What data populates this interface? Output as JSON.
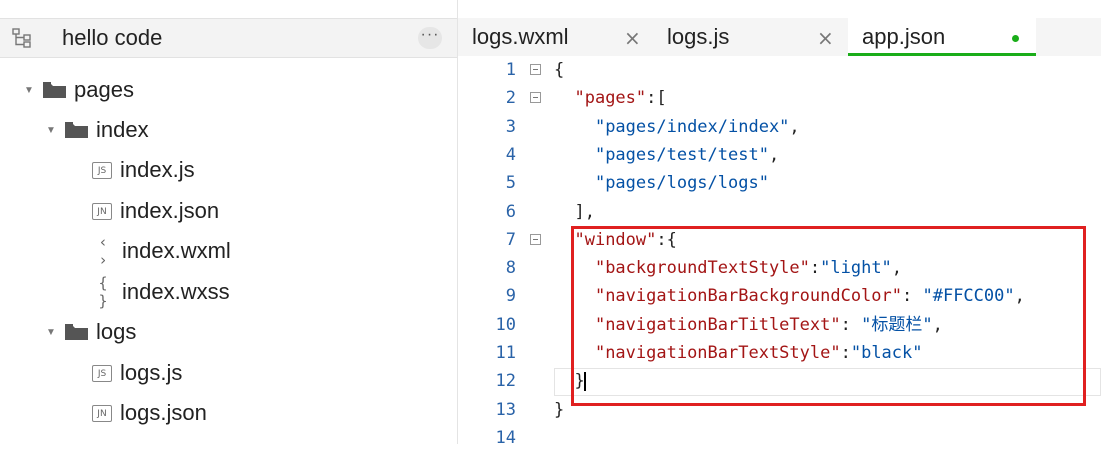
{
  "sidebar": {
    "project_name": "hello code",
    "more_label": "···",
    "tree": [
      {
        "label": "pages",
        "kind": "folder"
      },
      {
        "label": "index",
        "kind": "folder"
      },
      {
        "label": "index.js",
        "kind": "file",
        "badge": "JS"
      },
      {
        "label": "index.json",
        "kind": "file",
        "badge": "JN"
      },
      {
        "label": "index.wxml",
        "kind": "file",
        "badge": "‹ ›"
      },
      {
        "label": "index.wxss",
        "kind": "file",
        "badge": "{ }"
      },
      {
        "label": "logs",
        "kind": "folder"
      },
      {
        "label": "logs.js",
        "kind": "file",
        "badge": "JS"
      },
      {
        "label": "logs.json",
        "kind": "file",
        "badge": "JN"
      }
    ]
  },
  "tabs": [
    {
      "label": "logs.wxml",
      "close": "×"
    },
    {
      "label": "logs.js",
      "close": "×"
    },
    {
      "label": "app.json",
      "active": true,
      "modified": true
    }
  ],
  "editor": {
    "line_numbers": [
      "1",
      "2",
      "3",
      "4",
      "5",
      "6",
      "7",
      "8",
      "9",
      "10",
      "11",
      "12",
      "13",
      "14"
    ],
    "lines": [
      {
        "parts": [
          {
            "t": "{",
            "c": "p"
          }
        ]
      },
      {
        "parts": [
          {
            "t": "  ",
            "c": "p"
          },
          {
            "t": "\"pages\"",
            "c": "s"
          },
          {
            "t": ":[",
            "c": "p"
          }
        ]
      },
      {
        "parts": [
          {
            "t": "    ",
            "c": "p"
          },
          {
            "t": "\"pages/index/index\"",
            "c": "v"
          },
          {
            "t": ",",
            "c": "p"
          }
        ]
      },
      {
        "parts": [
          {
            "t": "    ",
            "c": "p"
          },
          {
            "t": "\"pages/test/test\"",
            "c": "v"
          },
          {
            "t": ",",
            "c": "p"
          }
        ]
      },
      {
        "parts": [
          {
            "t": "    ",
            "c": "p"
          },
          {
            "t": "\"pages/logs/logs\"",
            "c": "v"
          }
        ]
      },
      {
        "parts": [
          {
            "t": "  ],",
            "c": "p"
          }
        ]
      },
      {
        "parts": [
          {
            "t": "  ",
            "c": "p"
          },
          {
            "t": "\"window\"",
            "c": "s"
          },
          {
            "t": ":{",
            "c": "p"
          }
        ]
      },
      {
        "parts": [
          {
            "t": "    ",
            "c": "p"
          },
          {
            "t": "\"backgroundTextStyle\"",
            "c": "s"
          },
          {
            "t": ":",
            "c": "p"
          },
          {
            "t": "\"light\"",
            "c": "v"
          },
          {
            "t": ",",
            "c": "p"
          }
        ]
      },
      {
        "parts": [
          {
            "t": "    ",
            "c": "p"
          },
          {
            "t": "\"navigationBarBackgroundColor\"",
            "c": "s"
          },
          {
            "t": ": ",
            "c": "p"
          },
          {
            "t": "\"#FFCC00\"",
            "c": "v"
          },
          {
            "t": ",",
            "c": "p"
          }
        ]
      },
      {
        "parts": [
          {
            "t": "    ",
            "c": "p"
          },
          {
            "t": "\"navigationBarTitleText\"",
            "c": "s"
          },
          {
            "t": ": ",
            "c": "p"
          },
          {
            "t": "\"标题栏\"",
            "c": "v"
          },
          {
            "t": ",",
            "c": "p"
          }
        ]
      },
      {
        "parts": [
          {
            "t": "    ",
            "c": "p"
          },
          {
            "t": "\"navigationBarTextStyle\"",
            "c": "s"
          },
          {
            "t": ":",
            "c": "p"
          },
          {
            "t": "\"black\"",
            "c": "v"
          }
        ]
      },
      {
        "parts": [
          {
            "t": "  }",
            "c": "p"
          }
        ],
        "cursor": true
      },
      {
        "parts": [
          {
            "t": "}",
            "c": "p"
          }
        ]
      },
      {
        "parts": []
      }
    ],
    "foldable_lines": [
      1,
      2,
      7
    ]
  },
  "colors": {
    "accent": "#1aad19",
    "highlight_box": "#e02020",
    "line_number": "#2a63a8",
    "key_string": "#a31515",
    "value_string": "#0451a5"
  },
  "icons": {
    "tree_toggle": "tree-icon",
    "folder": "folder-icon",
    "expanded": "caret-down-icon"
  }
}
